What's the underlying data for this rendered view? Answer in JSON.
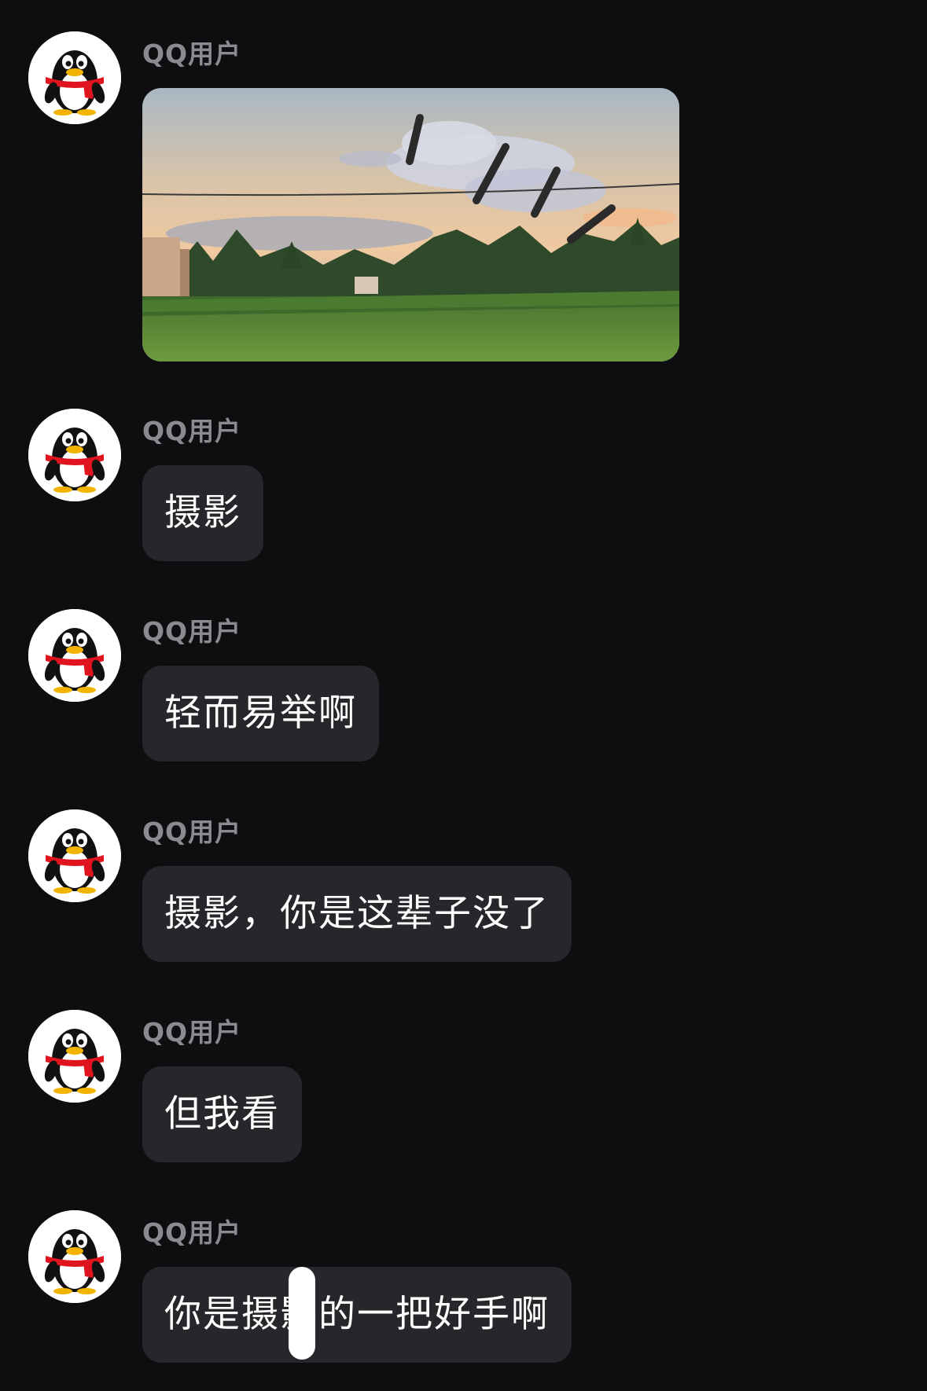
{
  "messages": [
    {
      "sender": "QQ用户",
      "type": "image"
    },
    {
      "sender": "QQ用户",
      "type": "text",
      "text": "摄影"
    },
    {
      "sender": "QQ用户",
      "type": "text",
      "text": "轻而易举啊"
    },
    {
      "sender": "QQ用户",
      "type": "text",
      "text": "摄影，你是这辈子没了"
    },
    {
      "sender": "QQ用户",
      "type": "text",
      "text": "但我看"
    },
    {
      "sender": "QQ用户",
      "type": "text",
      "text": "你是摄影的一把好手啊"
    }
  ],
  "colors": {
    "background": "#0e0e10",
    "bubble": "#27272b",
    "sender_name": "#8a8a8f",
    "message_text": "#ffffff"
  },
  "icons": {
    "avatar": "qq-penguin-avatar-icon"
  }
}
